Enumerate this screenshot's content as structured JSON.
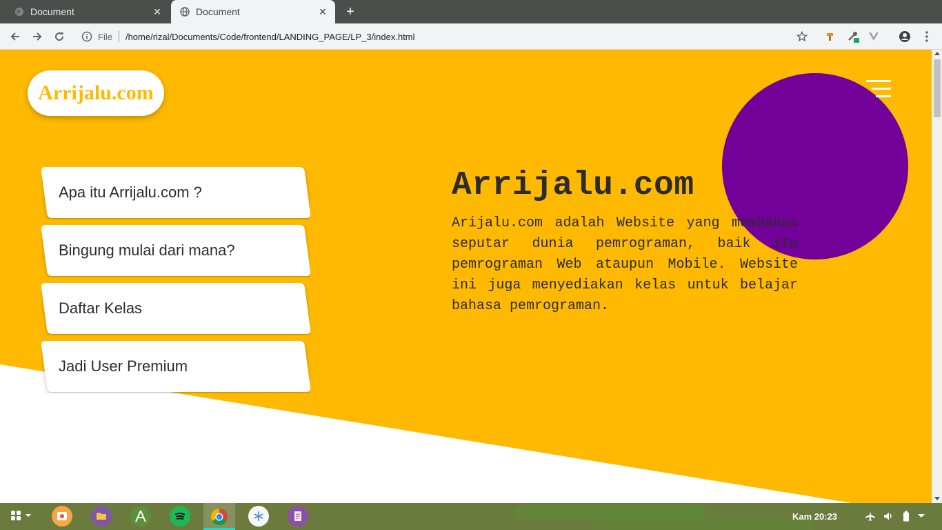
{
  "browser": {
    "tabs": [
      {
        "title": "Document",
        "active": false
      },
      {
        "title": "Document",
        "active": true
      }
    ],
    "address": {
      "scheme_label": "File",
      "url": "/home/rizal/Documents/Code/frontend/LANDING_PAGE/LP_3/index.html"
    }
  },
  "page": {
    "logo_text": "Arrijalu.com",
    "menu_items": [
      "Apa itu Arrijalu.com ?",
      "Bingung mulai dari mana?",
      "Daftar Kelas",
      "Jadi User Premium"
    ],
    "hero": {
      "title": "Arrijalu.com",
      "description": "Arijalu.com adalah Website yang membahas seputar dunia pemrograman, baik itu pemrograman Web ataupun Mobile. Website ini juga menyediakan kelas untuk belajar bahasa pemrograman."
    },
    "colors": {
      "primary_yellow": "#ffb900",
      "accent_purple": "#720099"
    }
  },
  "taskbar": {
    "clock": "Kam 20:23",
    "apps": [
      "app-grid-icon",
      "screenshot-icon",
      "files-icon",
      "android-studio-icon",
      "spotify-icon",
      "chrome-icon",
      "vscode-icon",
      "text-editor-icon"
    ]
  }
}
